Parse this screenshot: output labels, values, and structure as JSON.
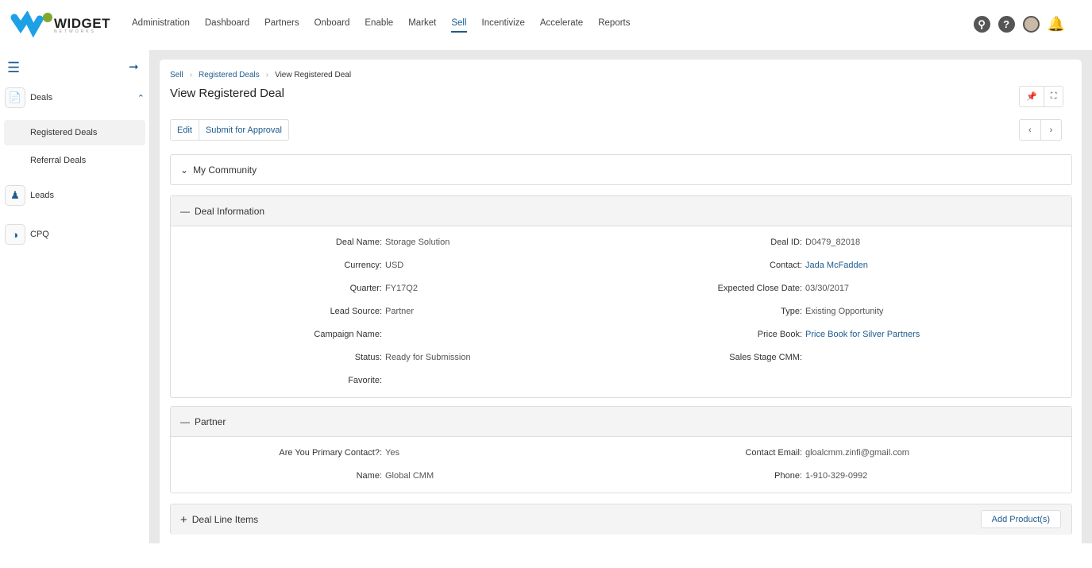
{
  "brand": {
    "name": "WIDGET",
    "sub": "NETWORKS"
  },
  "nav": [
    "Administration",
    "Dashboard",
    "Partners",
    "Onboard",
    "Enable",
    "Market",
    "Sell",
    "Incentivize",
    "Accelerate",
    "Reports"
  ],
  "sidebar": {
    "deals": "Deals",
    "registered": "Registered Deals",
    "referral": "Referral Deals",
    "leads": "Leads",
    "cpq": "CPQ"
  },
  "breadcrumb": [
    "Sell",
    "Registered Deals",
    "View Registered Deal"
  ],
  "title": "View Registered Deal",
  "actions": {
    "edit": "Edit",
    "submit": "Submit for Approval"
  },
  "sections": {
    "community": "My Community",
    "deal_info": "Deal Information",
    "partner": "Partner",
    "line_items": "Deal Line Items",
    "add_product": "Add Product(s)"
  },
  "deal_left": [
    [
      "Deal Name:",
      "Storage Solution"
    ],
    [
      "Currency:",
      "USD"
    ],
    [
      "Quarter:",
      "FY17Q2"
    ],
    [
      "Lead Source:",
      "Partner"
    ],
    [
      "Campaign Name:",
      ""
    ],
    [
      "Status:",
      "Ready for Submission"
    ],
    [
      "Favorite:",
      ""
    ]
  ],
  "deal_right": [
    [
      "Deal ID:",
      "D0479_82018"
    ],
    [
      "Contact:",
      "Jada McFadden"
    ],
    [
      "Expected Close Date:",
      "03/30/2017"
    ],
    [
      "Type:",
      "Existing Opportunity"
    ],
    [
      "Price Book:",
      "Price Book for Silver Partners"
    ],
    [
      "Sales Stage CMM:",
      ""
    ]
  ],
  "partner_left": [
    [
      "Are You Primary Contact?:",
      "Yes"
    ],
    [
      "Name:",
      "Global CMM"
    ]
  ],
  "partner_right": [
    [
      "Contact Email:",
      "gloalcmm.zinfi@gmail.com"
    ],
    [
      "Phone:",
      "1-910-329-0992"
    ]
  ]
}
